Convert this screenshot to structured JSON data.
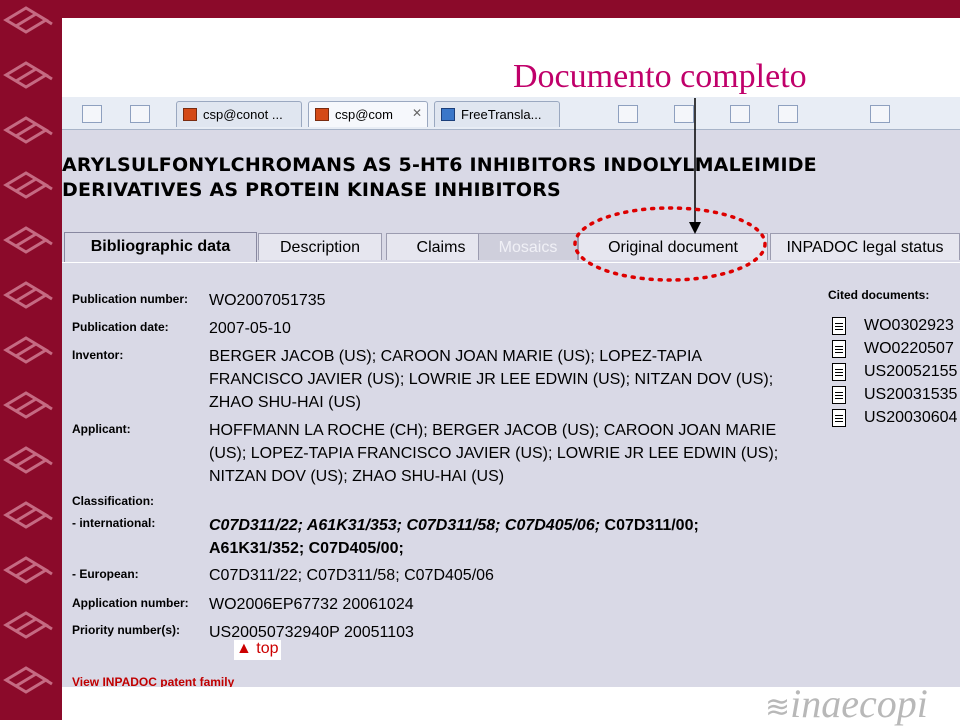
{
  "slide": {
    "callout": "Documento completo",
    "logo": "inaecopi"
  },
  "browser": {
    "tabs": [
      {
        "label": "csp@conot ..."
      },
      {
        "label": "csp@com"
      },
      {
        "label": "FreeTransla..."
      }
    ]
  },
  "page": {
    "title_line1": "ARYLSULFONYLCHROMANS AS 5-HT6 INHIBITORS INDOLYLMALEIMIDE",
    "title_line2": "DERIVATIVES AS PROTEIN KINASE INHIBITORS",
    "tabs": [
      {
        "label": "Bibliographic data",
        "state": "active"
      },
      {
        "label": "Description",
        "state": "normal"
      },
      {
        "label": "Claims",
        "state": "normal"
      },
      {
        "label": "Mosaics",
        "state": "disabled"
      },
      {
        "label": "Original document",
        "state": "highlighted"
      },
      {
        "label": "INPADOC legal status",
        "state": "normal"
      }
    ],
    "fields": {
      "publication_number": {
        "label": "Publication number:",
        "value": "WO2007051735"
      },
      "publication_date": {
        "label": "Publication date:",
        "value": "2007-05-10"
      },
      "inventor": {
        "label": "Inventor:",
        "lines": [
          "BERGER JACOB (US); CAROON JOAN MARIE (US); LOPEZ-TAPIA",
          "FRANCISCO JAVIER (US); LOWRIE JR LEE EDWIN (US); NITZAN DOV (US);",
          "ZHAO SHU-HAI (US)"
        ]
      },
      "applicant": {
        "label": "Applicant:",
        "lines": [
          "HOFFMANN LA ROCHE (CH); BERGER JACOB (US); CAROON JOAN MARIE",
          "(US); LOPEZ-TAPIA FRANCISCO JAVIER (US); LOWRIE JR LEE EDWIN (US);",
          "NITZAN DOV (US); ZHAO SHU-HAI (US)"
        ]
      },
      "classification": {
        "label": "Classification:"
      },
      "international": {
        "label": "- international:",
        "line1_italic": "C07D311/22; A61K31/353; C07D311/58; C07D405/06;",
        "line1_bold": " C07D311/00;",
        "line2": "A61K31/352; C07D405/00;"
      },
      "european": {
        "label": "- European:",
        "value": "C07D311/22; C07D311/58; C07D405/06"
      },
      "application_number": {
        "label": "Application number:",
        "value": "WO2006EP67732 20061024"
      },
      "priority_numbers": {
        "label": "Priority number(s):",
        "value": "US20050732940P 20051103"
      }
    },
    "top_link": "▲ top",
    "inpadoc_link": "View INPADOC patent family",
    "cited": {
      "title": "Cited documents:",
      "items": [
        "WO0302923",
        "WO0220507",
        "US20052155",
        "US20031535",
        "US20030604"
      ]
    }
  },
  "colors": {
    "band": "#8b0a2a",
    "callout": "#c0006a",
    "highlight": "#dd0000",
    "page_bg": "#d9d9e6"
  }
}
